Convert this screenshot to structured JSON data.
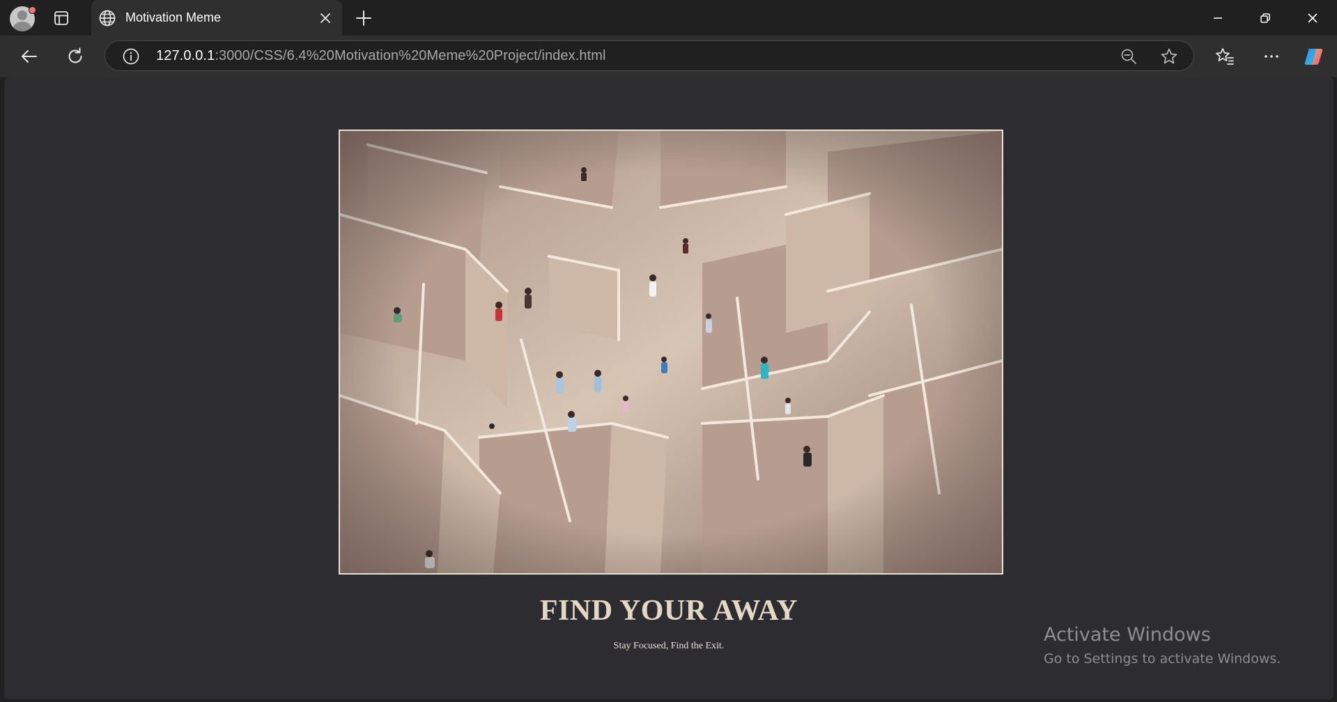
{
  "browser": {
    "tab": {
      "title": "Motivation Meme",
      "favicon_icon": "globe-icon"
    },
    "address_bar": {
      "url_host": "127.0.0.1",
      "url_path": ":3000/CSS/6.4%20Motivation%20Meme%20Project/index.html"
    },
    "icons": {
      "profile": "profile-avatar-icon",
      "tab_actions": "tab-actions-icon",
      "close_tab": "close-icon",
      "new_tab": "plus-icon",
      "back": "back-arrow-icon",
      "reload": "reload-icon",
      "site_info": "info-icon",
      "zoom": "zoom-out-icon",
      "favorite": "star-icon",
      "favorites": "favorites-icon",
      "more": "more-icon",
      "copilot": "copilot-icon"
    },
    "colors": {
      "chrome": "#202020",
      "active_tab": "#2f2f2f",
      "page_background": "#2d2d31"
    }
  },
  "page": {
    "image": {
      "subject": "maze-photo",
      "border_color": "#e9e2d4"
    },
    "heading": "FIND YOUR AWAY",
    "caption": "Stay Focused, Find the Exit."
  },
  "watermark": {
    "title": "Activate Windows",
    "subtitle": "Go to Settings to activate Windows."
  }
}
